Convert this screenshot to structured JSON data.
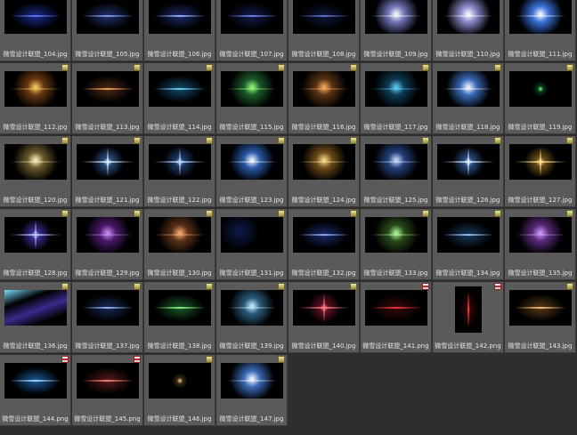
{
  "items": [
    {
      "label": "微雪设计联盟_104.jpg",
      "type": "jpg",
      "colors": [
        "#6a7cff",
        "#1a2a8a"
      ],
      "shape": "streak"
    },
    {
      "label": "微雪设计联盟_105.jpg",
      "type": "jpg",
      "colors": [
        "#8fa8ff",
        "#22306a"
      ],
      "shape": "streak"
    },
    {
      "label": "微雪设计联盟_106.jpg",
      "type": "jpg",
      "colors": [
        "#a0b8ff",
        "#1e2a6a"
      ],
      "shape": "streak"
    },
    {
      "label": "微雪设计联盟_107.jpg",
      "type": "jpg",
      "colors": [
        "#7a8cff",
        "#141c50"
      ],
      "shape": "streak"
    },
    {
      "label": "微雪设计联盟_108.jpg",
      "type": "jpg",
      "colors": [
        "#6a78d8",
        "#10183c"
      ],
      "shape": "streak"
    },
    {
      "label": "微雪设计联盟_109.jpg",
      "type": "jpg",
      "colors": [
        "#ffffff",
        "#6f74b8"
      ],
      "shape": "flare"
    },
    {
      "label": "微雪设计联盟_110.jpg",
      "type": "jpg",
      "colors": [
        "#ffffff",
        "#8a86c8"
      ],
      "shape": "flare"
    },
    {
      "label": "微雪设计联盟_111.jpg",
      "type": "jpg",
      "colors": [
        "#ffffff",
        "#3a70d8"
      ],
      "shape": "flare"
    },
    {
      "label": "微雪设计联盟_112.jpg",
      "type": "jpg",
      "colors": [
        "#ffcc66",
        "#6a3a12"
      ],
      "shape": "flare"
    },
    {
      "label": "微雪设计联盟_113.jpg",
      "type": "jpg",
      "colors": [
        "#ffaa55",
        "#4a2a18"
      ],
      "shape": "streak"
    },
    {
      "label": "微雪设计联盟_114.jpg",
      "type": "jpg",
      "colors": [
        "#7ad8ff",
        "#124a6a"
      ],
      "shape": "streak"
    },
    {
      "label": "微雪设计联盟_115.jpg",
      "type": "jpg",
      "colors": [
        "#9aff7a",
        "#1a5a2a"
      ],
      "shape": "flare"
    },
    {
      "label": "微雪设计联盟_116.jpg",
      "type": "jpg",
      "colors": [
        "#ffb060",
        "#5a3414"
      ],
      "shape": "flare"
    },
    {
      "label": "微雪设计联盟_117.jpg",
      "type": "jpg",
      "colors": [
        "#60d0ff",
        "#0e3a52"
      ],
      "shape": "flare"
    },
    {
      "label": "微雪设计联盟_118.jpg",
      "type": "jpg",
      "colors": [
        "#ffffff",
        "#3a6ab8"
      ],
      "shape": "flare"
    },
    {
      "label": "微雪设计联盟_119.jpg",
      "type": "jpg",
      "colors": [
        "#7aff8a",
        "#0a3a1a"
      ],
      "shape": "dot"
    },
    {
      "label": "微雪设计联盟_120.jpg",
      "type": "jpg",
      "colors": [
        "#fff2c0",
        "#6a5a2a"
      ],
      "shape": "flare"
    },
    {
      "label": "微雪设计联盟_121.jpg",
      "type": "jpg",
      "colors": [
        "#d8e8ff",
        "#2a4a7a"
      ],
      "shape": "star"
    },
    {
      "label": "微雪设计联盟_122.jpg",
      "type": "jpg",
      "colors": [
        "#c0d8ff",
        "#1e3a6a"
      ],
      "shape": "star"
    },
    {
      "label": "微雪设计联盟_123.jpg",
      "type": "jpg",
      "colors": [
        "#ffffff",
        "#2a5aa8"
      ],
      "shape": "flare"
    },
    {
      "label": "微雪设计联盟_124.jpg",
      "type": "jpg",
      "colors": [
        "#ffe08a",
        "#6a4a1a"
      ],
      "shape": "flare"
    },
    {
      "label": "微雪设计联盟_125.jpg",
      "type": "jpg",
      "colors": [
        "#cfe0ff",
        "#24407a"
      ],
      "shape": "flare"
    },
    {
      "label": "微雪设计联盟_126.jpg",
      "type": "jpg",
      "colors": [
        "#e0ecff",
        "#2a4a80"
      ],
      "shape": "star"
    },
    {
      "label": "微雪设计联盟_127.jpg",
      "type": "jpg",
      "colors": [
        "#ffe090",
        "#6a5018"
      ],
      "shape": "star"
    },
    {
      "label": "微雪设计联盟_128.jpg",
      "type": "jpg",
      "colors": [
        "#b8c8ff",
        "#3a2a8a"
      ],
      "shape": "star"
    },
    {
      "label": "微雪设计联盟_129.jpg",
      "type": "jpg",
      "colors": [
        "#d090ff",
        "#4a1a6a"
      ],
      "shape": "flare"
    },
    {
      "label": "微雪设计联盟_130.jpg",
      "type": "jpg",
      "colors": [
        "#ffb070",
        "#5a3018"
      ],
      "shape": "flare"
    },
    {
      "label": "微雪设计联盟_131.jpg",
      "type": "jpg",
      "colors": [
        "#6a8aff",
        "#0e1a4a"
      ],
      "shape": "dots"
    },
    {
      "label": "微雪设计联盟_132.jpg",
      "type": "jpg",
      "colors": [
        "#9ab0ff",
        "#1a2a6a"
      ],
      "shape": "streak"
    },
    {
      "label": "微雪设计联盟_133.jpg",
      "type": "jpg",
      "colors": [
        "#b0ff9a",
        "#2a4a1a"
      ],
      "shape": "flare"
    },
    {
      "label": "微雪设计联盟_134.jpg",
      "type": "jpg",
      "colors": [
        "#9ad0ff",
        "#1a3a5a"
      ],
      "shape": "streak"
    },
    {
      "label": "微雪设计联盟_135.jpg",
      "type": "jpg",
      "colors": [
        "#d0a0ff",
        "#5a2a7a"
      ],
      "shape": "flare"
    },
    {
      "label": "微雪设计联盟_136.jpg",
      "type": "jpg",
      "colors": [
        "#7ae0ff",
        "#3a2a8a"
      ],
      "shape": "rays"
    },
    {
      "label": "微雪设计联盟_137.jpg",
      "type": "jpg",
      "colors": [
        "#a0c0ff",
        "#1a2a5a"
      ],
      "shape": "streak"
    },
    {
      "label": "微雪设计联盟_138.jpg",
      "type": "jpg",
      "colors": [
        "#8aff8a",
        "#1a5a2a"
      ],
      "shape": "streak"
    },
    {
      "label": "微雪设计联盟_139.jpg",
      "type": "jpg",
      "colors": [
        "#d0f0ff",
        "#2a5a7a"
      ],
      "shape": "flare"
    },
    {
      "label": "微雪设计联盟_140.jpg",
      "type": "jpg",
      "colors": [
        "#ff7a8a",
        "#5a1020"
      ],
      "shape": "star"
    },
    {
      "label": "微雪设计联盟_141.png",
      "type": "png",
      "colors": [
        "#ff3a3a",
        "#3a0a0a"
      ],
      "shape": "streak"
    },
    {
      "label": "微雪设计联盟_142.png",
      "type": "png",
      "colors": [
        "#ff4040",
        "#3a0808"
      ],
      "shape": "vstreak"
    },
    {
      "label": "微雪设计联盟_143.jpg",
      "type": "jpg",
      "colors": [
        "#ffcc80",
        "#5a3a18"
      ],
      "shape": "streak"
    },
    {
      "label": "微雪设计联盟_144.png",
      "type": "png",
      "colors": [
        "#b0e0ff",
        "#1a5a9a"
      ],
      "shape": "streak"
    },
    {
      "label": "微雪设计联盟_145.png",
      "type": "png",
      "colors": [
        "#ff8a80",
        "#5a1a1a"
      ],
      "shape": "streak"
    },
    {
      "label": "微雪设计联盟_146.jpg",
      "type": "jpg",
      "colors": [
        "#ffe0a0",
        "#3a2a10"
      ],
      "shape": "dot"
    },
    {
      "label": "微雪设计联盟_147.jpg",
      "type": "jpg",
      "colors": [
        "#ffffff",
        "#3a6ab8"
      ],
      "shape": "flare"
    }
  ]
}
